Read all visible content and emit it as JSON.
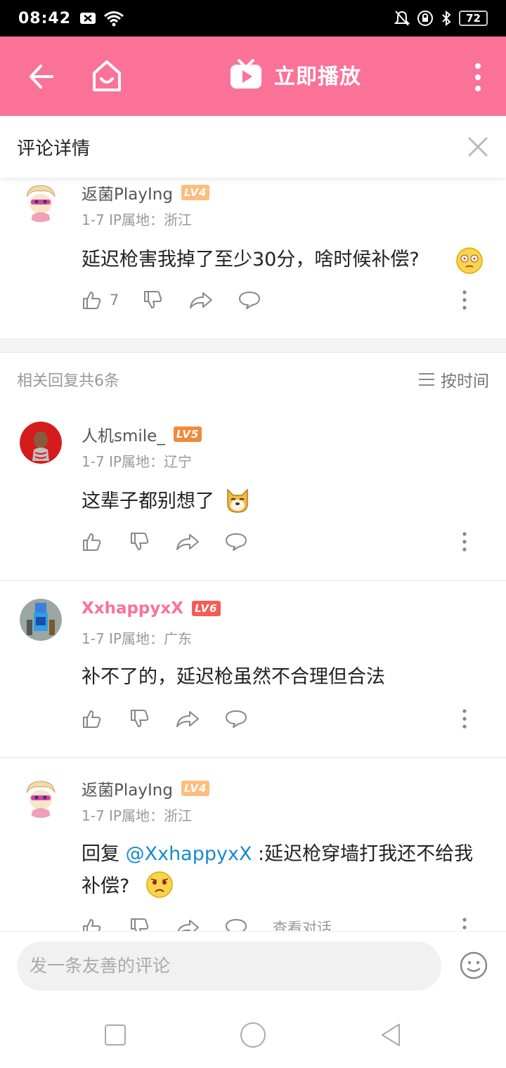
{
  "status": {
    "time": "08:42",
    "battery": "72"
  },
  "appbar": {
    "play_label": "立即播放"
  },
  "subheader": {
    "title": "评论详情"
  },
  "root_comment": {
    "username": "返菌PlayIng",
    "level": "LV4",
    "date": "1-7",
    "ip_location": "IP属地：浙江",
    "text": "延迟枪害我掉了至少30分，啥时候补偿?",
    "likes": "7"
  },
  "replies_header": {
    "count_label": "相关回复共6条",
    "sort_label": "按时间"
  },
  "replies": [
    {
      "username": "人机smile_",
      "level": "LV5",
      "date": "1-7",
      "ip_location": "IP属地：辽宁",
      "text": "这辈子都别想了"
    },
    {
      "username": "XxhappyxX",
      "level": "LV6",
      "date": "1-7",
      "ip_location": "IP属地：广东",
      "text": "补不了的，延迟枪虽然不合理但合法"
    },
    {
      "username": "返菌PlayIng",
      "level": "LV4",
      "date": "1-7",
      "ip_location": "IP属地：浙江",
      "reply_prefix": "回复 ",
      "mention": "@XxhappyxX",
      "text": " :延迟枪穿墙打我还不给我补偿?",
      "view_conversation": "查看对话"
    }
  ],
  "composer": {
    "placeholder": "发一条友善的评论"
  },
  "colors": {
    "brand_pink": "#fb7299",
    "mention_blue": "#178bcf"
  },
  "icons": [
    "back-icon",
    "home-icon",
    "tv-play-icon",
    "more-vertical-icon",
    "close-icon",
    "like-icon",
    "dislike-icon",
    "share-icon",
    "comment-icon",
    "sort-icon",
    "emoji-icon"
  ]
}
